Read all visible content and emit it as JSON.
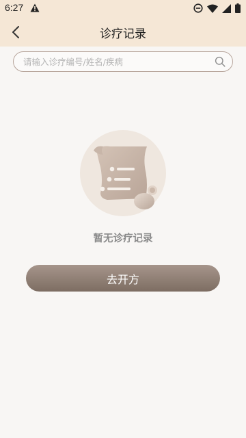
{
  "status_bar": {
    "time": "6:27"
  },
  "header": {
    "title": "诊疗记录"
  },
  "search": {
    "placeholder": "请输入诊疗编号/姓名/疾病"
  },
  "empty_state": {
    "message": "暂无诊疗记录"
  },
  "actions": {
    "prescribe_label": "去开方"
  },
  "colors": {
    "header_bg": "#f5e7d6",
    "page_bg": "#f8f6f4",
    "accent_brown": "#8b7a6e",
    "search_border": "#b7a59b"
  },
  "icons": {
    "back": "chevron-left-icon",
    "search": "search-icon",
    "empty": "scroll-document-icon"
  }
}
